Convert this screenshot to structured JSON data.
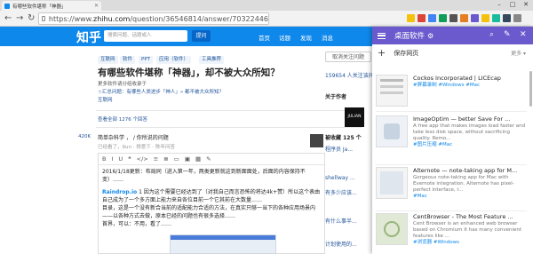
{
  "browser": {
    "tab_title": "有哪些软件堪称「神器」",
    "url_prefix": "https://www.",
    "url_domain": "zhihu.com",
    "url_path": "/question/36546814/answer/70322446",
    "back": "←",
    "forward": "→",
    "reload": "↻",
    "minimize": "–",
    "maximize": "□",
    "close": "✕"
  },
  "zhihu": {
    "logo": "知乎",
    "search_placeholder": "搜索问题、话题或人",
    "ask_label": "提问",
    "nav": [
      "首页",
      "话题",
      "发现",
      "消息"
    ],
    "tags": [
      "互联网",
      "软件",
      "PPT",
      "应用（软件）",
      "工具推荐"
    ],
    "question_title": "有哪些软件堪称「神器」，却不被大众所知？",
    "q_line1": "更多软件请分组收录于",
    "q_line2": "☆汇总问题：有哪些人类进步「神人」»   都不被大众所知？",
    "q_line3": "互联网",
    "comments": "查看全部 1276 个回答",
    "side_count": "420K",
    "answer_author": "简单杂科学 ，  /  你所说的问题",
    "answer_sub": "已经看了，9un · 得意下 · 陈年问答",
    "editor_tools": [
      "B",
      "I",
      "U",
      "❝",
      "</>",
      "≡",
      "≣",
      "▭",
      "▣",
      "▦",
      "✎"
    ],
    "editor_text_1": "2016/1/18更新：布局同（进入第一年，两类更新就这到新面面处，后面的内容保持不变）……",
    "editor_link": "Raindrop.io",
    "editor_text_2": "1 因为这个需要已经达到了（对我自己而言恐怖的将达4k+赞）所以这个表由自己成为了一个多方面上能力来自各位目前一个它其前在大数量……",
    "editor_text_3": "目录，这是一个没有新合当前的适配能力合适的方法，在真实只够一当下的各种应用场景内——以各种方式去做，原本已经的问题也有很多选择……",
    "editor_text_4": "首界，可以：不用，看了……"
  },
  "sidebar": {
    "follow_btn": "取消关注问题",
    "count_label": "159654 人关注该问题",
    "h1": "关于作者",
    "name": "JULIAN",
    "recent": "被收藏 125 个",
    "r1": "程序员 Ja...",
    "r2": "shellway ...",
    "r3": "有多少应该...",
    "r4": "有什么事半...",
    "r5": "计划使用的..."
  },
  "panel": {
    "title": "桌面软件",
    "save_label": "保存网页",
    "more_label": "更多 ▾",
    "accent": "#6a5acd",
    "cards": [
      {
        "title": "Cockos Incorporated | LICEcap",
        "desc": "",
        "tags": "#屏幕录制 #Windows #Mac"
      },
      {
        "title": "ImageOptim — better Save For ...",
        "desc": "A free app that makes images load faster and take less disk space, without sacrificing quality. Remo...",
        "tags": "#图片压缩 #Mac"
      },
      {
        "title": "Alternote — note-taking app for M...",
        "desc": "Gorgeous note-taking app for Mac with Evernote integration. Alternote has pixel-perfect interface, r...",
        "tags": "#Mac"
      },
      {
        "title": "CentBrowser - The Most Feature ...",
        "desc": "Cent Browser is an enhanced web browser based on Chromium It has many convenient features like ...",
        "tags": "#浏览器 #Windows"
      }
    ]
  }
}
